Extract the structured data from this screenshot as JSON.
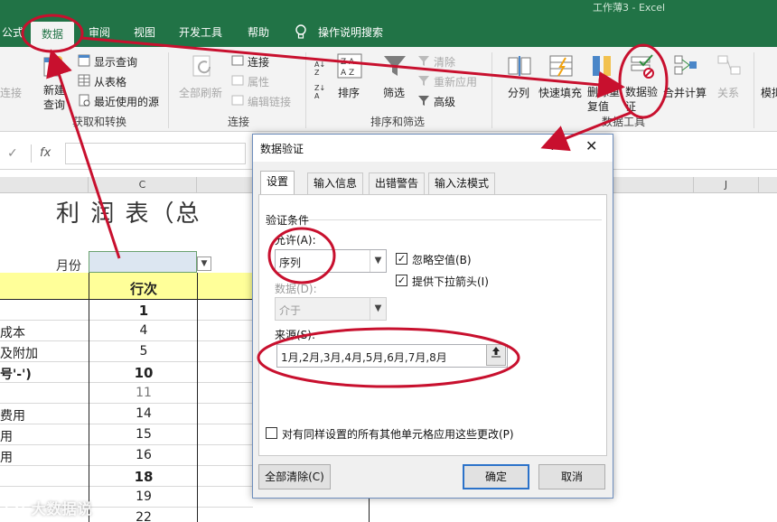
{
  "window": {
    "title": "工作薄3 - Excel"
  },
  "tabs": [
    {
      "label": "公式"
    },
    {
      "label": "数据"
    },
    {
      "label": "审阅"
    },
    {
      "label": "视图"
    },
    {
      "label": "开发工具"
    },
    {
      "label": "帮助"
    },
    {
      "label": "操作说明搜索"
    }
  ],
  "ribbon": {
    "get_transform": {
      "connect_left": "连接",
      "new_query": "新建查询",
      "show_query": "显示查询",
      "from_table": "从表格",
      "recent_sources": "最近使用的源",
      "group": "获取和转换"
    },
    "connections": {
      "refresh_all": "全部刷新",
      "connections": "连接",
      "properties": "属性",
      "edit_links": "编辑链接",
      "group": "连接"
    },
    "sort_filter": {
      "sort": "排序",
      "filter": "筛选",
      "clear": "清除",
      "reapply": "重新应用",
      "advanced": "高级",
      "group": "排序和筛选"
    },
    "data_tools": {
      "split": "分列",
      "flash_fill": "快速填充",
      "remove_dup": "删除重复值",
      "validation": "数据验证",
      "consolidate": "合并计算",
      "relations": "关系",
      "group": "数据工具"
    },
    "forecast": {
      "whatif": "模拟"
    }
  },
  "formula_bar": {
    "fx": "fx"
  },
  "sheet": {
    "column_c": "C",
    "column_j": "J",
    "title": "利 润 表（总",
    "month_label": "月份",
    "row_header": "行次",
    "rows": [
      {
        "a": "",
        "c": "1"
      },
      {
        "a": "成本",
        "c": "4"
      },
      {
        "a": "及附加",
        "c": "5"
      },
      {
        "a": "号'-')",
        "c": "10"
      },
      {
        "a": "",
        "c": "11"
      },
      {
        "a": "费用",
        "c": "14"
      },
      {
        "a": "用",
        "c": "15"
      },
      {
        "a": "用",
        "c": "16"
      },
      {
        "a": "",
        "c": "18"
      },
      {
        "a": "",
        "c": "19"
      },
      {
        "a": "",
        "c": "22"
      }
    ]
  },
  "dialog": {
    "title": "数据验证",
    "help": "?",
    "close": "✕",
    "tabs": [
      "设置",
      "输入信息",
      "出错警告",
      "输入法模式"
    ],
    "section": "验证条件",
    "allow_label": "允许(A):",
    "allow_value": "序列",
    "ignore_blank": "忽略空值(B)",
    "dropdown": "提供下拉箭头(I)",
    "data_label": "数据(D):",
    "data_value": "介于",
    "source_label": "来源(S):",
    "source_value": "1月,2月,3月,4月,5月,6月,7月,8月",
    "apply_all": "对有同样设置的所有其他单元格应用这些更改(P)",
    "clear_all": "全部清除(C)",
    "ok": "确定",
    "cancel": "取消"
  },
  "watermark": "大数据说",
  "colors": {
    "excel_green": "#217346",
    "annotation_red": "#c8102e",
    "header_yellow": "#ffff99",
    "ok_border": "#2b72c9"
  }
}
